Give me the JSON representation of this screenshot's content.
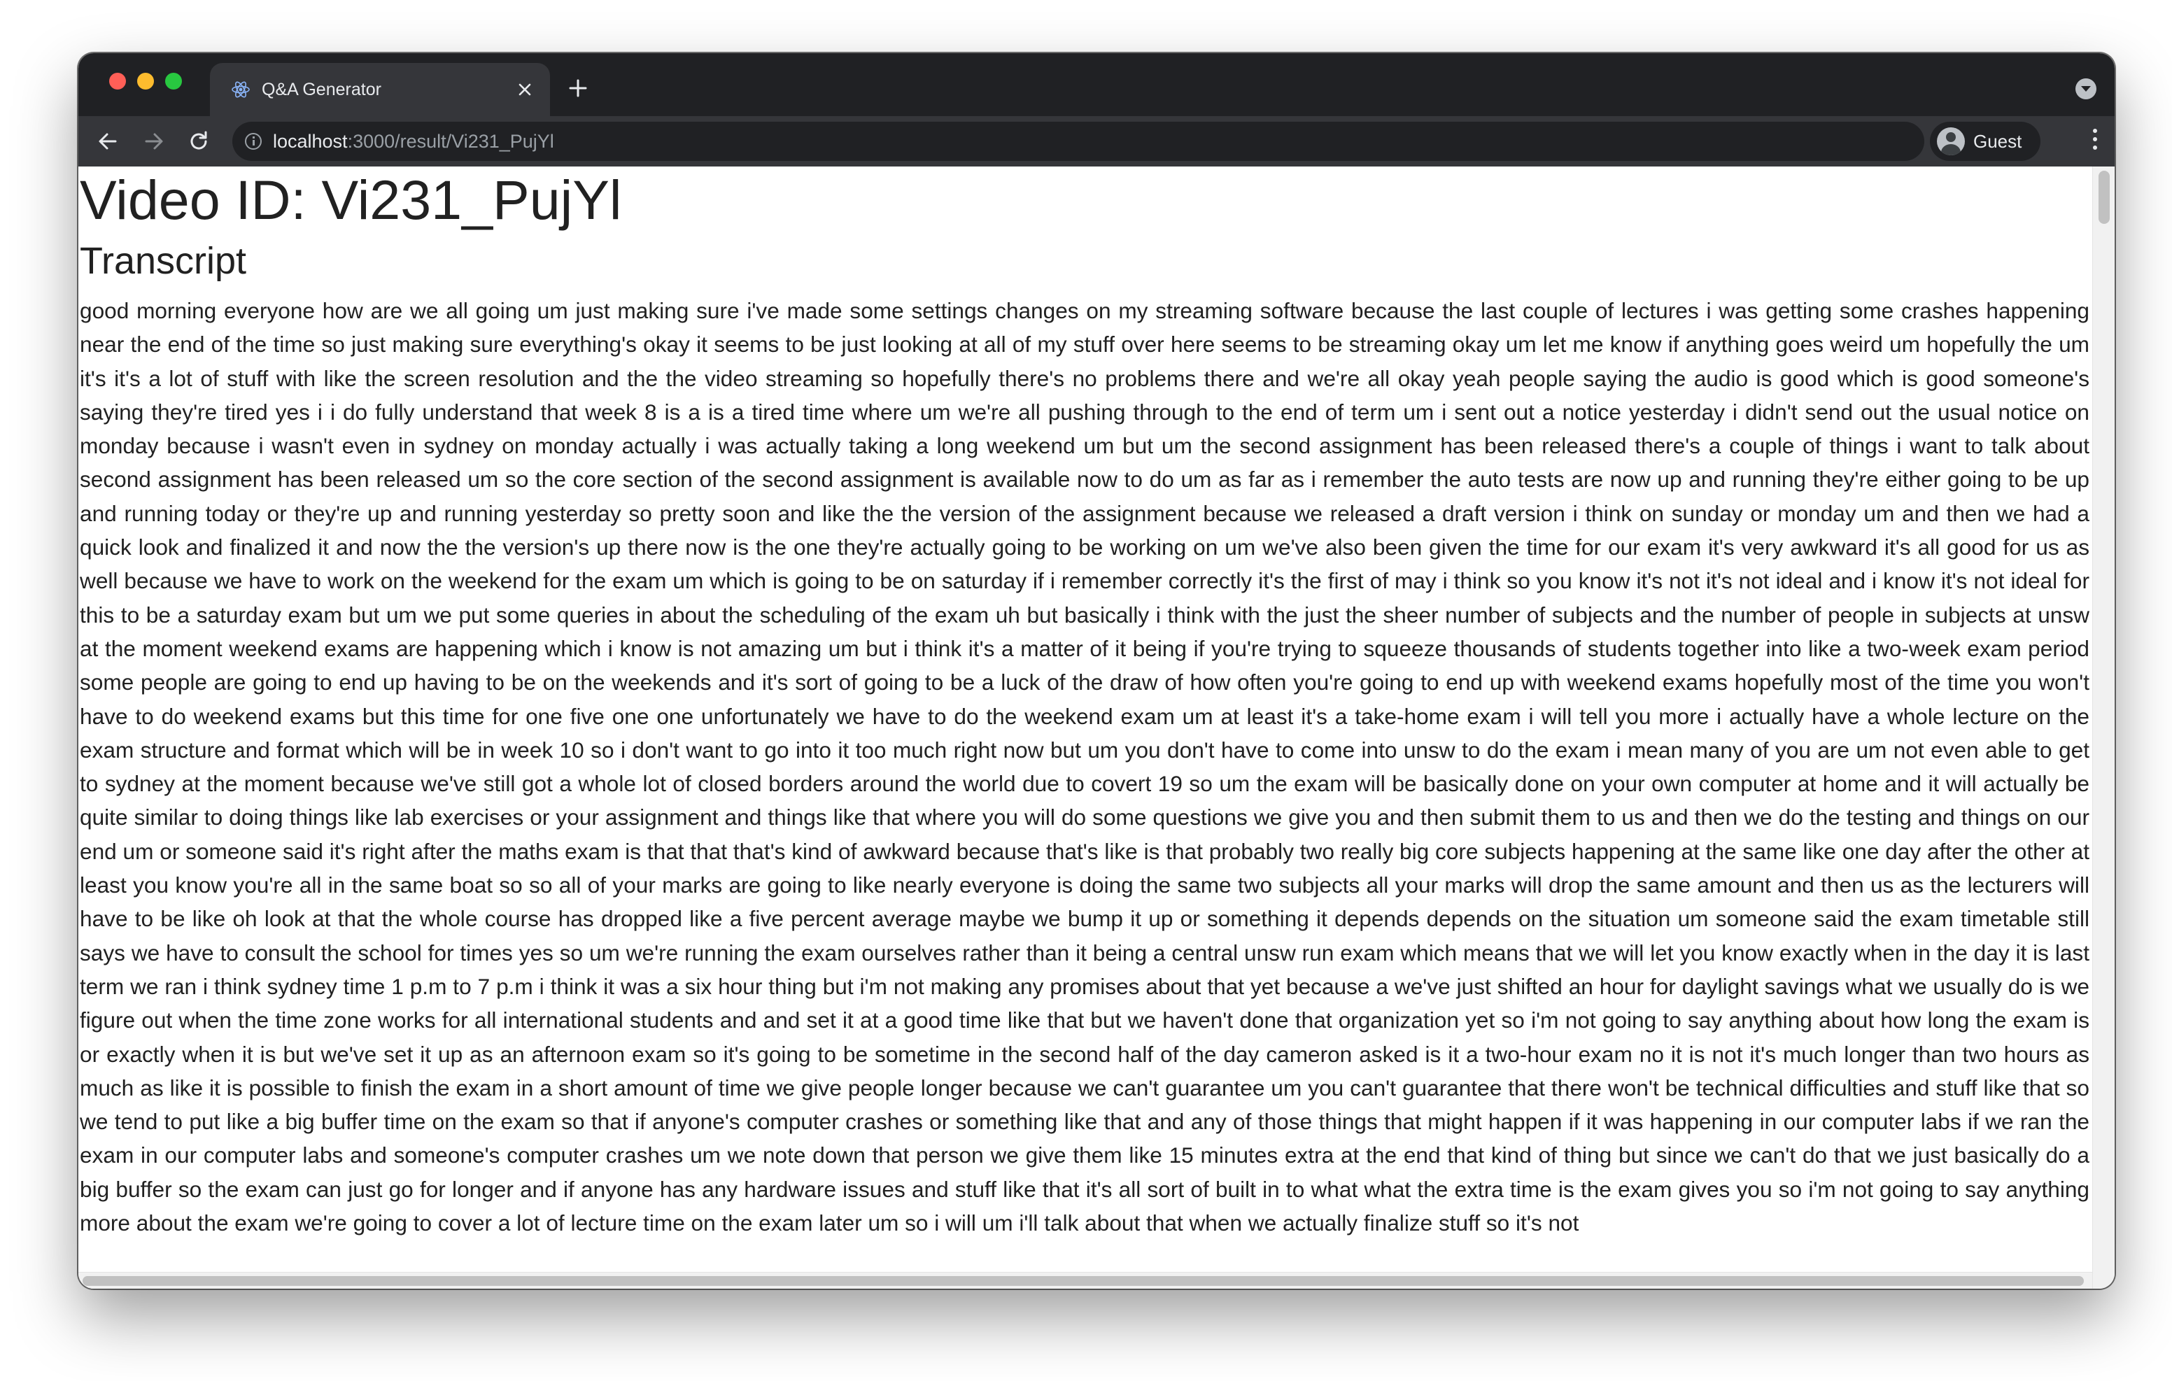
{
  "browser": {
    "tab": {
      "title": "Q&A Generator",
      "favicon": "react-atom-icon"
    },
    "address_bar": {
      "host": "localhost",
      "path": ":3000/result/Vi231_PujYl"
    },
    "profile": {
      "label": "Guest"
    }
  },
  "page": {
    "title": "Video ID: Vi231_PujYl",
    "transcript_heading": "Transcript",
    "transcript": "good morning everyone how are we all going um just making sure i've made some settings changes on my streaming software because the last couple of lectures i was getting some crashes happening near the end of the time so just making sure everything's okay it seems to be just looking at all of my stuff over here seems to be streaming okay um let me know if anything goes weird um hopefully the um it's it's a lot of stuff with like the screen resolution and the the video streaming so hopefully there's no problems there and we're all okay yeah people saying the audio is good which is good someone's saying they're tired yes i i do fully understand that week 8 is a is a tired time where um we're all pushing through to the end of term um i sent out a notice yesterday i didn't send out the usual notice on monday because i wasn't even in sydney on monday actually i was actually taking a long weekend um but um the second assignment has been released there's a couple of things i want to talk about second assignment has been released um so the core section of the second assignment is available now to do um as far as i remember the auto tests are now up and running they're either going to be up and running today or they're up and running yesterday so pretty soon and like the the version of the assignment because we released a draft version i think on sunday or monday um and then we had a quick look and finalized it and now the the version's up there now is the one they're actually going to be working on um we've also been given the time for our exam it's very awkward it's all good for us as well because we have to work on the weekend for the exam um which is going to be on saturday if i remember correctly it's the first of may i think so you know it's not it's not ideal and i know it's not ideal for this to be a saturday exam but um we put some queries in about the scheduling of the exam uh but basically i think with the just the sheer number of subjects and the number of people in subjects at unsw at the moment weekend exams are happening which i know is not amazing um but i think it's a matter of it being if you're trying to squeeze thousands of students together into like a two-week exam period some people are going to end up having to be on the weekends and it's sort of going to be a luck of the draw of how often you're going to end up with weekend exams hopefully most of the time you won't have to do weekend exams but this time for one five one one unfortunately we have to do the weekend exam um at least it's a take-home exam i will tell you more i actually have a whole lecture on the exam structure and format which will be in week 10 so i don't want to go into it too much right now but um you don't have to come into unsw to do the exam i mean many of you are um not even able to get to sydney at the moment because we've still got a whole lot of closed borders around the world due to covert 19 so um the exam will be basically done on your own computer at home and it will actually be quite similar to doing things like lab exercises or your assignment and things like that where you will do some questions we give you and then submit them to us and then we do the testing and things on our end um or someone said it's right after the maths exam is that that that's kind of awkward because that's like is that probably two really big core subjects happening at the same like one day after the other at least you know you're all in the same boat so so all of your marks are going to like nearly everyone is doing the same two subjects all your marks will drop the same amount and then us as the lecturers will have to be like oh look at that the whole course has dropped like a five percent average maybe we bump it up or something it depends depends on the situation um someone said the exam timetable still says we have to consult the school for times yes so um we're running the exam ourselves rather than it being a central unsw run exam which means that we will let you know exactly when in the day it is last term we ran i think sydney time 1 p.m to 7 p.m i think it was a six hour thing but i'm not making any promises about that yet because a we've just shifted an hour for daylight savings what we usually do is we figure out when the time zone works for all international students and and set it at a good time like that but we haven't done that organization yet so i'm not going to say anything about how long the exam is or exactly when it is but we've set it up as an afternoon exam so it's going to be sometime in the second half of the day cameron asked is it a two-hour exam no it is not it's much longer than two hours as much as like it is possible to finish the exam in a short amount of time we give people longer because we can't guarantee um you can't guarantee that there won't be technical difficulties and stuff like that so we tend to put like a big buffer time on the exam so that if anyone's computer crashes or something like that and any of those things that might happen if it was happening in our computer labs if we ran the exam in our computer labs and someone's computer crashes um we note down that person we give them like 15 minutes extra at the end that kind of thing but since we can't do that we just basically do a big buffer so the exam can just go for longer and if anyone has any hardware issues and stuff like that it's all sort of built in to what what the extra time is the exam gives you so i'm not going to say anything more about the exam we're going to cover a lot of lecture time on the exam later um so i will um i'll talk about that when we actually finalize stuff so it's not"
  },
  "colors": {
    "tabstrip": "#202124",
    "toolbar": "#35363a",
    "text": "#212121"
  }
}
